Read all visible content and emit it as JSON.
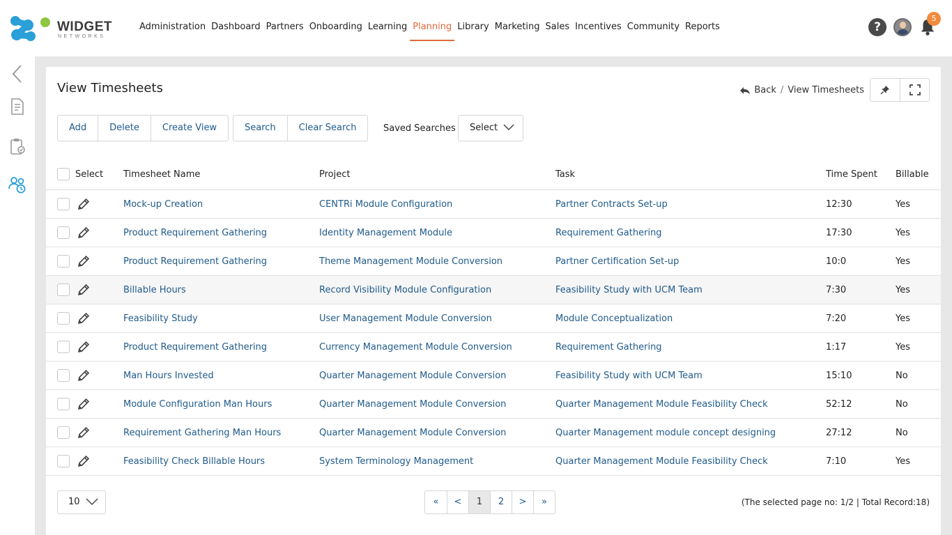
{
  "brand": {
    "name": "WIDGET",
    "sub": "NETWORKS"
  },
  "nav": [
    {
      "label": "Administration",
      "active": false
    },
    {
      "label": "Dashboard",
      "active": false
    },
    {
      "label": "Partners",
      "active": false
    },
    {
      "label": "Onboarding",
      "active": false
    },
    {
      "label": "Learning",
      "active": false
    },
    {
      "label": "Planning",
      "active": true
    },
    {
      "label": "Library",
      "active": false
    },
    {
      "label": "Marketing",
      "active": false
    },
    {
      "label": "Sales",
      "active": false
    },
    {
      "label": "Incentives",
      "active": false
    },
    {
      "label": "Community",
      "active": false
    },
    {
      "label": "Reports",
      "active": false
    }
  ],
  "header_icons": {
    "help_glyph": "?",
    "notification_count": "5"
  },
  "page": {
    "title": "View Timesheets",
    "breadcrumb_back": "Back",
    "breadcrumb_sep": "/",
    "breadcrumb_current": "View Timesheets"
  },
  "toolbar": {
    "add": "Add",
    "delete": "Delete",
    "create_view": "Create View",
    "search": "Search",
    "clear_search": "Clear Search",
    "saved_searches_label": "Saved Searches",
    "saved_searches_value": "Select"
  },
  "table": {
    "headers": {
      "select": "Select",
      "name": "Timesheet Name",
      "project": "Project",
      "task": "Task",
      "time": "Time Spent",
      "billable": "Billable"
    },
    "rows": [
      {
        "name": "Mock-up Creation",
        "project": "CENTRi Module Configuration",
        "task": "Partner Contracts Set-up",
        "time": "12:30",
        "billable": "Yes"
      },
      {
        "name": "Product Requirement Gathering",
        "project": "Identity Management Module",
        "task": "Requirement Gathering",
        "time": "17:30",
        "billable": "Yes"
      },
      {
        "name": "Product Requirement Gathering",
        "project": "Theme Management Module Conversion",
        "task": "Partner Certification Set-up",
        "time": "10:0",
        "billable": "Yes"
      },
      {
        "name": "Billable Hours",
        "project": "Record Visibility Module Configuration",
        "task": "Feasibility Study with UCM Team",
        "time": "7:30",
        "billable": "Yes"
      },
      {
        "name": "Feasibility Study",
        "project": "User Management Module Conversion",
        "task": "Module Conceptualization",
        "time": "7:20",
        "billable": "Yes"
      },
      {
        "name": "Product Requirement Gathering",
        "project": "Currency Management Module Conversion",
        "task": "Requirement Gathering",
        "time": "1:17",
        "billable": "Yes"
      },
      {
        "name": "Man Hours Invested",
        "project": "Quarter Management Module Conversion",
        "task": "Feasibility Study with UCM Team",
        "time": "15:10",
        "billable": "No"
      },
      {
        "name": "Module Configuration Man Hours",
        "project": "Quarter Management Module Conversion",
        "task": "Quarter Management Module Feasibility Check",
        "time": "52:12",
        "billable": "No"
      },
      {
        "name": "Requirement Gathering Man Hours",
        "project": "Quarter Management Module Conversion",
        "task": "Quarter Management module concept designing",
        "time": "27:12",
        "billable": "No"
      },
      {
        "name": "Feasibility Check Billable Hours",
        "project": "System Terminology Management",
        "task": "Quarter Management Module Feasibility Check",
        "time": "7:10",
        "billable": "Yes"
      }
    ]
  },
  "footer": {
    "per_page": "10",
    "pager": {
      "first": "«",
      "prev": "<",
      "page1": "1",
      "page2": "2",
      "next": ">",
      "last": "»"
    },
    "record_info": "(The selected page no: 1/2 | Total Record:18)"
  },
  "colors": {
    "accent": "#e4683a",
    "link": "#1f5a8a",
    "logo_blue": "#2a9fd8",
    "logo_green": "#8dc63f",
    "sidebar_active": "#2a9fd8",
    "badge": "#f28a3c"
  }
}
